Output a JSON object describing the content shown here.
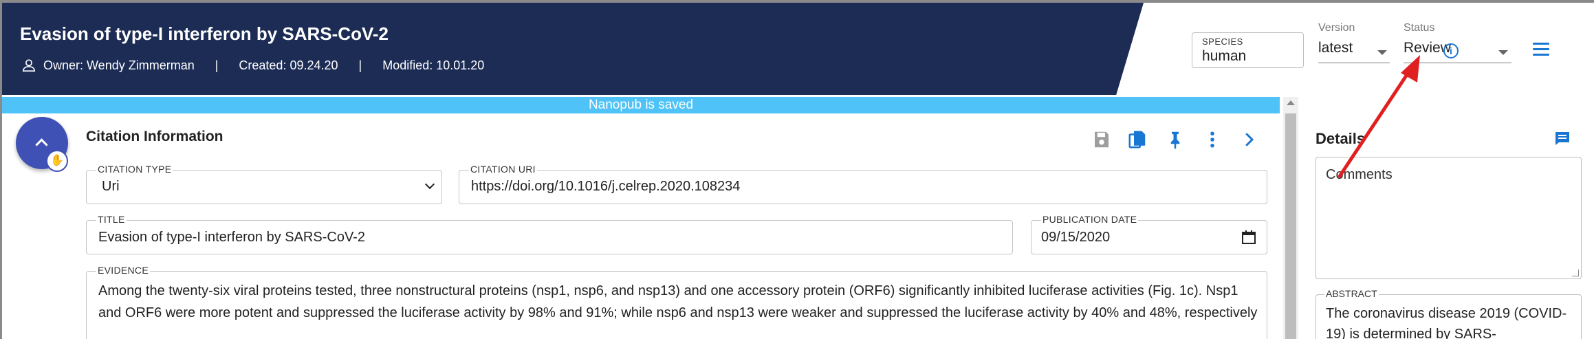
{
  "header": {
    "title": "Evasion of type-I interferon by SARS-CoV-2",
    "owner": "Owner: Wendy Zimmerman",
    "separator": "|",
    "created": "Created: 09.24.20",
    "modified": "Modified: 10.01.20",
    "species_label": "SPECIES",
    "species_value": "human",
    "version_label": "Version",
    "version_value": "latest",
    "status_label": "Status",
    "status_value": "Review"
  },
  "banner": {
    "text": "Nanopub is saved"
  },
  "citation": {
    "section_title": "Citation Information",
    "citation_type_label": "CITATION TYPE",
    "citation_type_value": "Uri",
    "citation_uri_label": "CITATION URI",
    "citation_uri_value": "https://doi.org/10.1016/j.celrep.2020.108234",
    "title_label": "TITLE",
    "title_value": "Evasion of type-I interferon by SARS-CoV-2",
    "pubdate_label": "PUBLICATION DATE",
    "pubdate_value": "09/15/2020",
    "evidence_label": "EVIDENCE",
    "evidence_value": "Among the twenty-six viral proteins tested, three nonstructural proteins (nsp1, nsp6, and nsp13) and one accessory protein (ORF6) significantly inhibited luciferase activities (Fig. 1c). Nsp1 and ORF6 were more potent and suppressed the luciferase activity by 98% and 91%; while nsp6 and nsp13 were weaker and suppressed the luciferase activity by 40% and 48%, respectively"
  },
  "details": {
    "title": "Details",
    "comments_placeholder": "Comments",
    "abstract_label": "ABSTRACT",
    "abstract_value": "The coronavirus disease 2019 (COVID-19) is determined by SARS-"
  },
  "colors": {
    "header_bg": "#1c2c55",
    "accent": "#1976d2",
    "banner": "#4fc3f7",
    "fab": "#3f51b5",
    "annotation_arrow": "#e02020"
  },
  "icons": [
    "user-icon",
    "info-icon",
    "menu-icon",
    "chevron-up-icon",
    "hand-pointer-icon",
    "save-icon",
    "copy-icon",
    "pin-icon",
    "more-vert-icon",
    "chevron-right-icon",
    "calendar-icon",
    "comment-icon"
  ]
}
